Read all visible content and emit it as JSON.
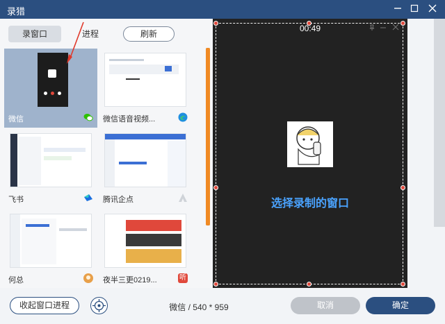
{
  "window": {
    "title": "录猎"
  },
  "tabs": {
    "window_tab": "录窗口",
    "process_tab": "进程",
    "refresh": "刷新"
  },
  "grid": {
    "items": [
      {
        "label": "微信",
        "icon": "wechat-icon",
        "icon_color": "#2dc100"
      },
      {
        "label": "微信语音视频...",
        "icon": "edge-icon",
        "icon_color": "#1f8fe0"
      },
      {
        "label": "飞书",
        "icon": "feishu-icon",
        "icon_color": "#1a6fe0"
      },
      {
        "label": "腾讯企点",
        "icon": "qidian-icon",
        "icon_color": "#cfd3d8"
      },
      {
        "label": "何总",
        "icon": "avatar-icon",
        "icon_color": "#e8a04a"
      },
      {
        "label": "夜半三更0219...",
        "icon": "app-icon",
        "icon_color": "#e0483b"
      }
    ],
    "icon_text_last": "听"
  },
  "preview": {
    "timer": "00:49",
    "message": "选择录制的窗口"
  },
  "bottom": {
    "collapse": "收起窗口进程",
    "info": "微信 / 540 * 959",
    "cancel": "取消",
    "ok": "确定"
  },
  "colors": {
    "accent": "#2b4f80",
    "scroll": "#f08a24",
    "handle": "#e0483b",
    "select_text": "#4aa3ff"
  }
}
